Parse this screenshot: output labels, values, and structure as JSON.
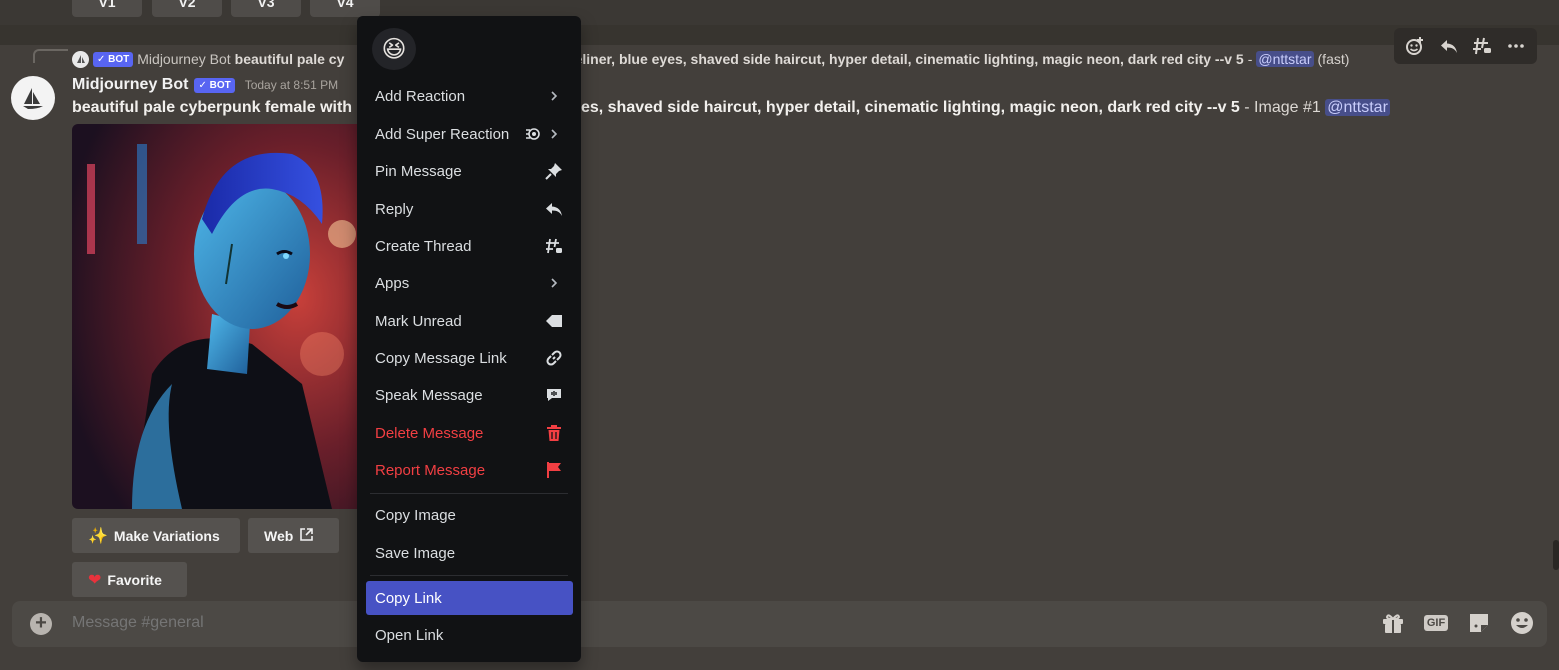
{
  "top_buttons": [
    "V1",
    "V2",
    "V3",
    "V4"
  ],
  "toolbar": {
    "icons": [
      "add-reaction-icon",
      "reply-icon",
      "create-thread-icon",
      "more-icon"
    ]
  },
  "reply": {
    "bot_tag": "✓ BOT",
    "author": "Midjourney Bot",
    "text": "beautiful pale cy",
    "text_tail": "k eyeliner, blue eyes, shaved side haircut, hyper detail, cinematic lighting, magic neon, dark red city --v 5",
    "dash": " - ",
    "mention": "@nttstar",
    "suffix": " (fast)"
  },
  "message": {
    "username": "Midjourney Bot",
    "bot_tag": "✓ BOT",
    "timestamp": "Today at 8:51 PM",
    "prompt_start": "beautiful pale cyberpunk female with",
    "prompt_end": "yes, shaved side haircut, hyper detail, cinematic lighting, magic neon, dark red city --v 5",
    "suffix": " - Image #1 ",
    "mention": "@nttstar"
  },
  "buttons": {
    "make_variations": "Make Variations",
    "web": "Web",
    "favorite": "Favorite"
  },
  "composer": {
    "placeholder": "Message #general",
    "gif": "GIF"
  },
  "context_menu": {
    "quick_emoji": "😆",
    "items": [
      {
        "label": "Add Reaction",
        "icon": "chevron-right-icon"
      },
      {
        "label": "Add Super Reaction",
        "icon": "super-reaction-icon"
      },
      {
        "label": "Pin Message",
        "icon": "pin-icon"
      },
      {
        "label": "Reply",
        "icon": "reply-icon"
      },
      {
        "label": "Create Thread",
        "icon": "thread-icon"
      },
      {
        "label": "Apps",
        "icon": "chevron-right-icon"
      },
      {
        "label": "Mark Unread",
        "icon": "mark-unread-icon"
      },
      {
        "label": "Copy Message Link",
        "icon": "link-icon"
      },
      {
        "label": "Speak Message",
        "icon": "speak-icon"
      },
      {
        "label": "Delete Message",
        "icon": "trash-icon",
        "danger": true
      },
      {
        "label": "Report Message",
        "icon": "flag-icon",
        "danger": true
      },
      {
        "label": "Copy Image"
      },
      {
        "label": "Save Image"
      },
      {
        "label": "Copy Link",
        "active": true
      },
      {
        "label": "Open Link"
      }
    ]
  },
  "colors": {
    "background": "#433f3b",
    "menu": "#111214",
    "accent": "#4752c4",
    "danger": "#f23f43",
    "bot_tag": "#5865f2"
  }
}
